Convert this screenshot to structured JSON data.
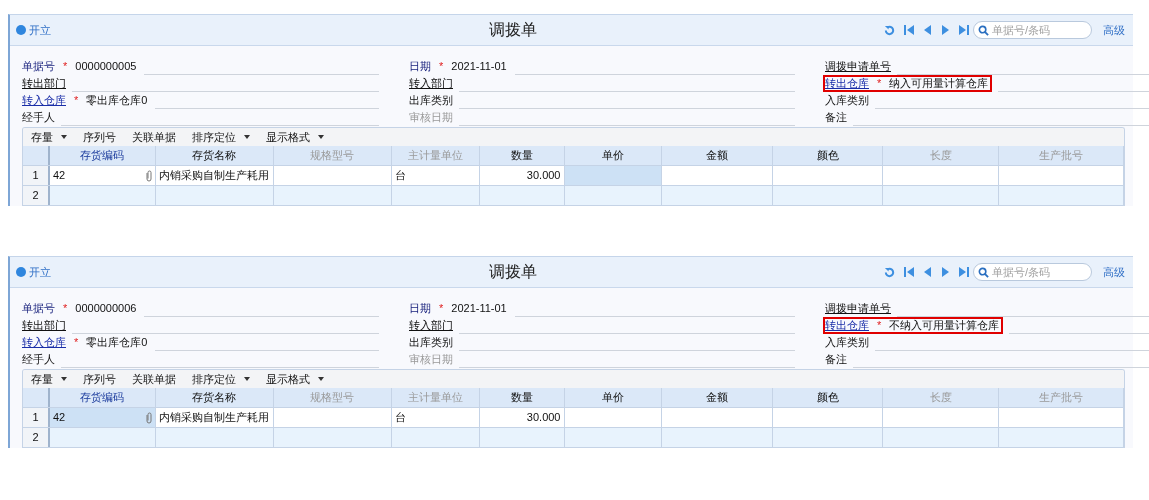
{
  "panels": [
    {
      "status": "开立",
      "title": "调拨单",
      "search": {
        "placeholder": "单据号/条码"
      },
      "advanced": "高级",
      "form_columns": [
        {
          "fields": [
            {
              "label": "单据号",
              "kind": "required",
              "marker": "*",
              "value": "0000000005",
              "highlighted": false
            },
            {
              "label": "转出部门",
              "kind": "ref",
              "highlighted": false
            },
            {
              "label": "转入仓库",
              "kind": "link",
              "marker": "*",
              "value": "零出库仓库0",
              "highlighted": false
            },
            {
              "label": "经手人",
              "kind": "plain",
              "highlighted": false
            }
          ]
        },
        {
          "fields": [
            {
              "label": "日期",
              "kind": "required",
              "marker": "*",
              "value": "2021-11-01",
              "highlighted": false
            },
            {
              "label": "转入部门",
              "kind": "ref",
              "highlighted": false
            },
            {
              "label": "出库类别",
              "kind": "plain",
              "highlighted": false
            },
            {
              "label": "审核日期",
              "kind": "disabled",
              "highlighted": false
            }
          ]
        },
        {
          "fields": [
            {
              "label": "调拨申请单号",
              "kind": "ref",
              "highlighted": false
            },
            {
              "label": "转出仓库",
              "kind": "link",
              "marker": "*",
              "value": "纳入可用量计算仓库",
              "highlighted": true
            },
            {
              "label": "入库类别",
              "kind": "plain",
              "highlighted": false
            },
            {
              "label": "备注",
              "kind": "plain",
              "highlighted": false
            }
          ]
        }
      ],
      "toolbar": [
        {
          "label": "存量",
          "dropdown": true
        },
        {
          "label": "序列号",
          "dropdown": false
        },
        {
          "label": "关联单据",
          "dropdown": false
        },
        {
          "label": "排序定位",
          "dropdown": true
        },
        {
          "label": "显示格式",
          "dropdown": true
        }
      ],
      "columns": [
        {
          "label": "存货编码",
          "kind": "key"
        },
        {
          "label": "存货名称",
          "kind": "text"
        },
        {
          "label": "规格型号",
          "kind": "readonly"
        },
        {
          "label": "主计量单位",
          "kind": "readonly"
        },
        {
          "label": "数量",
          "kind": "number"
        },
        {
          "label": "单价",
          "kind": "text"
        },
        {
          "label": "金额",
          "kind": "text"
        },
        {
          "label": "颜色",
          "kind": "text"
        },
        {
          "label": "长度",
          "kind": "readonly"
        },
        {
          "label": "生产批号",
          "kind": "readonly"
        }
      ],
      "rows": [
        {
          "number": "1",
          "cells": [
            {
              "text": "42",
              "attachment": true,
              "selected": false
            },
            {
              "text": "内销采购自制生产耗用",
              "selected": false
            },
            {
              "selected": false
            },
            {
              "text": "台",
              "selected": false
            },
            {
              "text": "30.000",
              "selected": false
            },
            {
              "selected": true
            },
            {
              "selected": false
            },
            {
              "selected": false
            },
            {
              "selected": false
            },
            {
              "selected": false
            }
          ]
        },
        {
          "number": "2",
          "cells": []
        }
      ]
    },
    {
      "status": "开立",
      "title": "调拨单",
      "search": {
        "placeholder": "单据号/条码"
      },
      "advanced": "高级",
      "form_columns": [
        {
          "fields": [
            {
              "label": "单据号",
              "kind": "required",
              "marker": "*",
              "value": "0000000006",
              "highlighted": false
            },
            {
              "label": "转出部门",
              "kind": "ref",
              "highlighted": false
            },
            {
              "label": "转入仓库",
              "kind": "link",
              "marker": "*",
              "value": "零出库仓库0",
              "highlighted": false
            },
            {
              "label": "经手人",
              "kind": "plain",
              "highlighted": false
            }
          ]
        },
        {
          "fields": [
            {
              "label": "日期",
              "kind": "required",
              "marker": "*",
              "value": "2021-11-01",
              "highlighted": false
            },
            {
              "label": "转入部门",
              "kind": "ref",
              "highlighted": false
            },
            {
              "label": "出库类别",
              "kind": "plain",
              "highlighted": false
            },
            {
              "label": "审核日期",
              "kind": "disabled",
              "highlighted": false
            }
          ]
        },
        {
          "fields": [
            {
              "label": "调拨申请单号",
              "kind": "ref",
              "highlighted": false
            },
            {
              "label": "转出仓库",
              "kind": "link",
              "marker": "*",
              "value": "不纳入可用量计算仓库",
              "highlighted": true
            },
            {
              "label": "入库类别",
              "kind": "plain",
              "highlighted": false
            },
            {
              "label": "备注",
              "kind": "plain",
              "highlighted": false
            }
          ]
        }
      ],
      "toolbar": [
        {
          "label": "存量",
          "dropdown": true
        },
        {
          "label": "序列号",
          "dropdown": false
        },
        {
          "label": "关联单据",
          "dropdown": false
        },
        {
          "label": "排序定位",
          "dropdown": true
        },
        {
          "label": "显示格式",
          "dropdown": true
        }
      ],
      "columns": [
        {
          "label": "存货编码",
          "kind": "key"
        },
        {
          "label": "存货名称",
          "kind": "text"
        },
        {
          "label": "规格型号",
          "kind": "readonly"
        },
        {
          "label": "主计量单位",
          "kind": "readonly"
        },
        {
          "label": "数量",
          "kind": "number"
        },
        {
          "label": "单价",
          "kind": "text"
        },
        {
          "label": "金额",
          "kind": "text"
        },
        {
          "label": "颜色",
          "kind": "text"
        },
        {
          "label": "长度",
          "kind": "readonly"
        },
        {
          "label": "生产批号",
          "kind": "readonly"
        }
      ],
      "rows": [
        {
          "number": "1",
          "cells": [
            {
              "text": "42",
              "attachment": true,
              "selected": true
            },
            {
              "text": "内销采购自制生产耗用",
              "selected": false
            },
            {
              "selected": false
            },
            {
              "text": "台",
              "selected": false
            },
            {
              "text": "30.000",
              "selected": false
            },
            {
              "selected": false
            },
            {
              "selected": false
            },
            {
              "selected": false
            },
            {
              "selected": false
            },
            {
              "selected": false
            }
          ]
        },
        {
          "number": "2",
          "cells": []
        }
      ]
    }
  ]
}
